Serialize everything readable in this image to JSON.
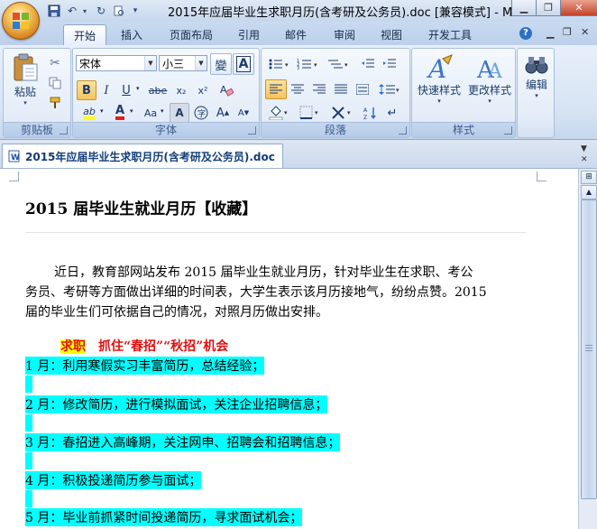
{
  "window": {
    "title": "2015年应届毕业生求职月历(含考研及公务员).doc [兼容模式] - M...",
    "minimize_icon": "minimize-icon",
    "restore_icon": "restore-icon",
    "close_icon": "close-icon"
  },
  "ribbon_tabs": [
    "开始",
    "插入",
    "页面布局",
    "引用",
    "邮件",
    "审阅",
    "视图",
    "开发工具"
  ],
  "active_tab": "开始",
  "groups": {
    "clipboard": {
      "label": "剪贴板",
      "paste": "粘贴"
    },
    "font": {
      "label": "字体",
      "font_name": "宋体",
      "font_size": "小三",
      "wen": "變",
      "bold": "B",
      "italic": "I",
      "underline": "U",
      "strike": "abe",
      "sub": "x₂",
      "sup": "x²",
      "aa": "Aa",
      "grow": "A",
      "shrink": "A",
      "font_color": "A",
      "highlight": "ab"
    },
    "paragraph": {
      "label": "段落"
    },
    "styles": {
      "label": "样式",
      "quick": "快速样式",
      "change": "更改样式"
    },
    "editing": {
      "label": "编辑"
    }
  },
  "document_tab": "2015年应届毕业生求职月历(含考研及公务员).doc",
  "document": {
    "heading": "2015 届毕业生就业月历【收藏】",
    "intro_lines": [
      "近日，教育部网站发布 2015 届毕业生就业月历，针对毕业生在求职、考公",
      "务员、考研等方面做出详细的时间表，大学生表示该月历接地气，纷纷点赞。2015",
      "届的毕业生们可依据自己的情况，对照月历做出安排。"
    ],
    "section_tag": "求职",
    "section_title": "抓住“春招”“秋招”机会",
    "months": [
      "1 月：利用寒假实习丰富简历，总结经验；",
      "2 月：修改简历，进行模拟面试，关注企业招聘信息；",
      "3 月：春招进入高峰期，关注网申、招聘会和招聘信息；",
      "4 月：积极投递简历参与面试；",
      "5 月：毕业前抓紧时间投递简历，寻求面试机会；"
    ]
  }
}
